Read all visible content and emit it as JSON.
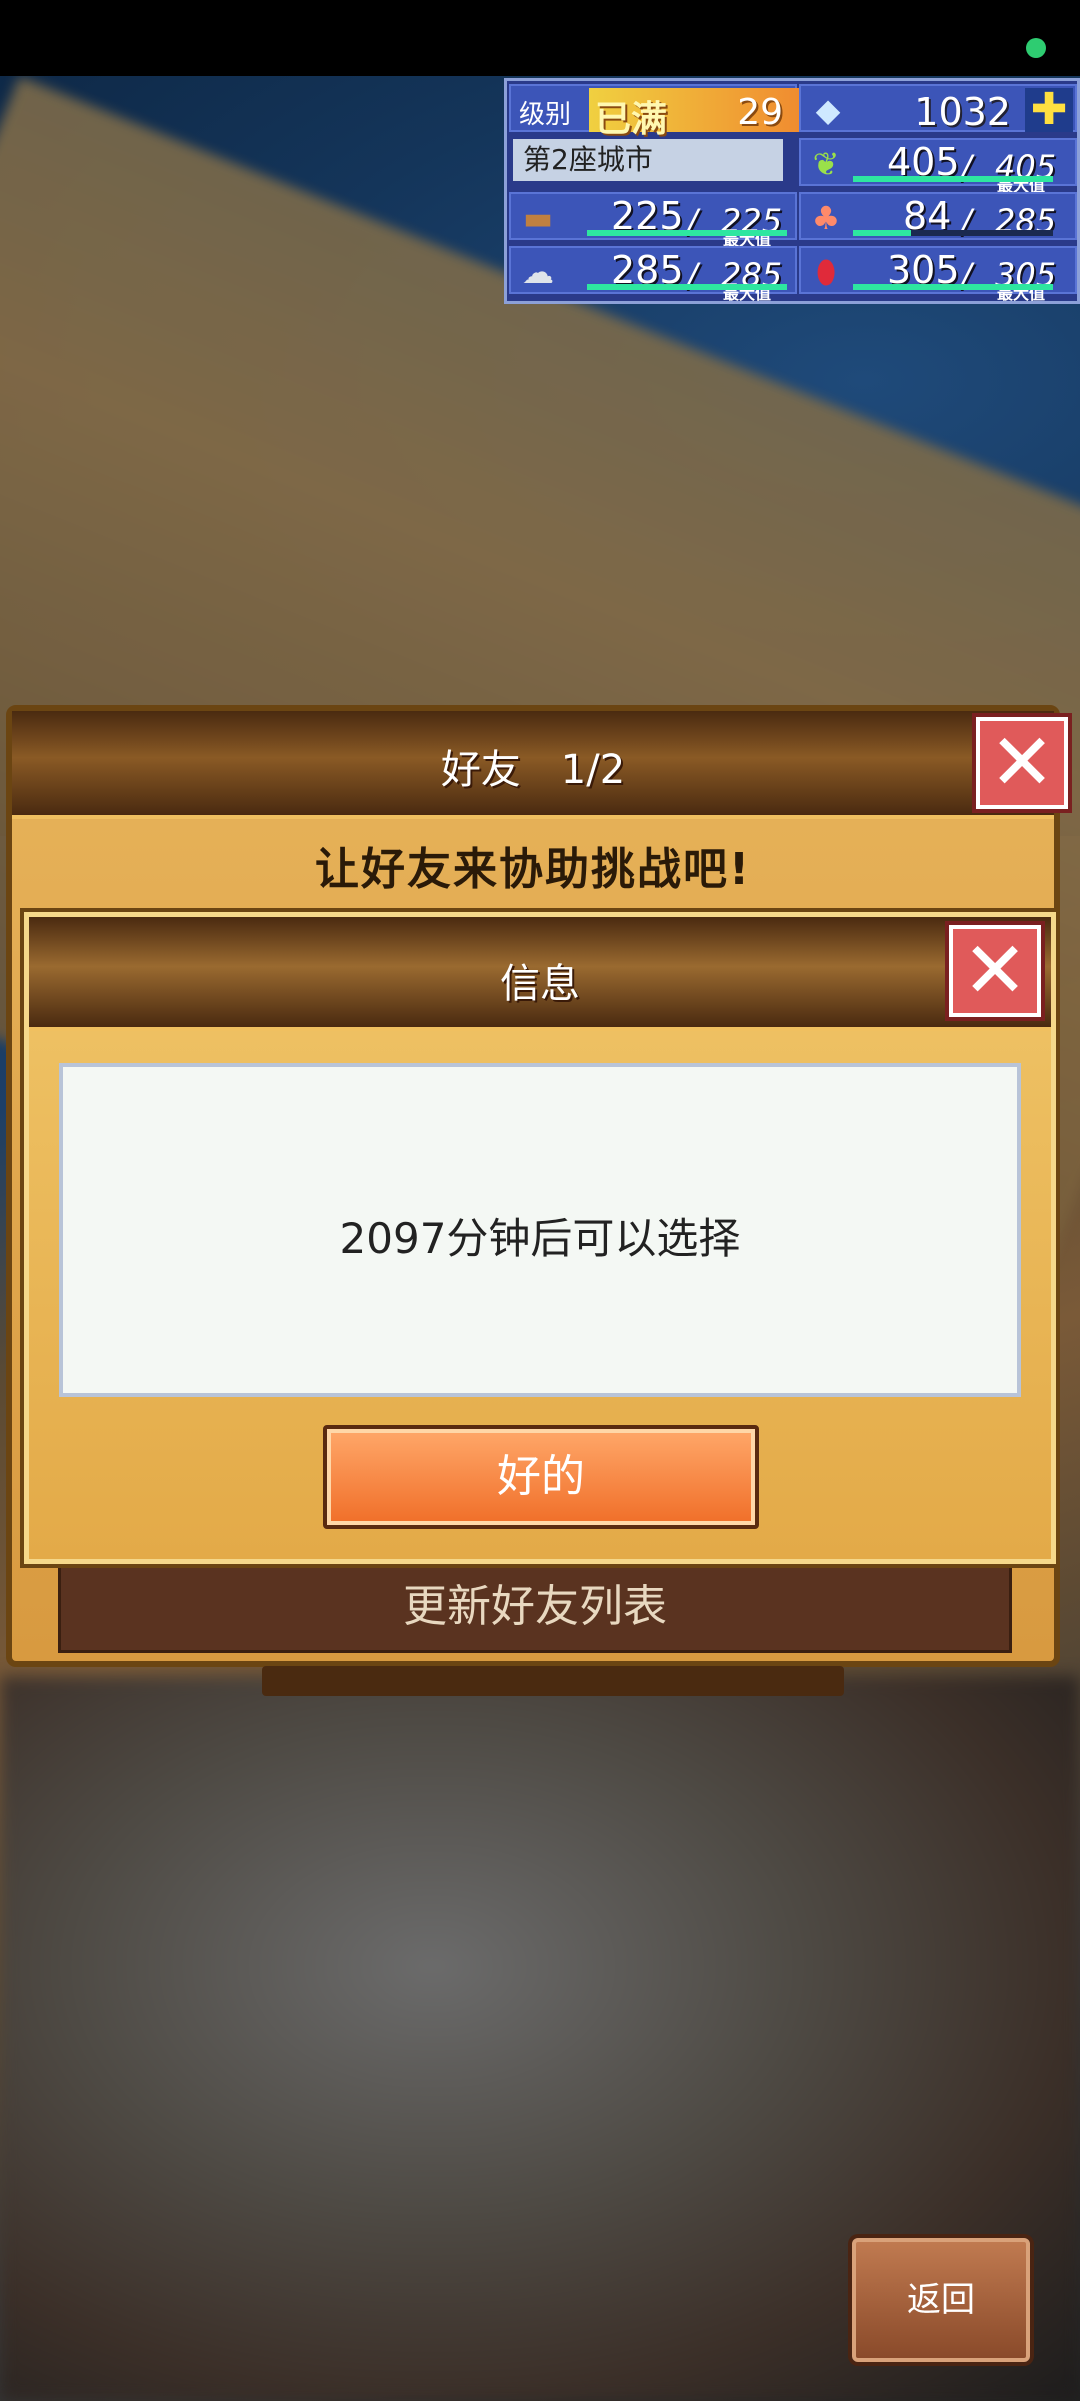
{
  "hud": {
    "level_label": "级别",
    "level_status": "已满",
    "level_value": "29",
    "gems": "1032",
    "city_name": "第2座城市",
    "max_tag": "最大值",
    "resources": [
      {
        "icon": "crop-icon",
        "value": "405",
        "max": "405",
        "fill": 1.0
      },
      {
        "icon": "wood-icon",
        "value": "225",
        "max": "225",
        "fill": 1.0
      },
      {
        "icon": "food-icon",
        "value": "84",
        "max": "285",
        "fill": 0.29
      },
      {
        "icon": "stone-icon",
        "value": "285",
        "max": "285",
        "fill": 1.0
      },
      {
        "icon": "ruby-icon",
        "value": "305",
        "max": "305",
        "fill": 1.0
      }
    ]
  },
  "friends_panel": {
    "title": "好友　1/2",
    "subtitle": "让好友来协助挑战吧!",
    "refresh_label": "更新好友列表"
  },
  "info_dialog": {
    "title": "信息",
    "message": "2097分钟后可以选择",
    "ok_label": "好的"
  },
  "back_label": "返回",
  "colors": {
    "accent": "#f06e28",
    "panel": "#e3aa48",
    "hud": "#2a3a8a",
    "bar": "#2ee6a0"
  }
}
